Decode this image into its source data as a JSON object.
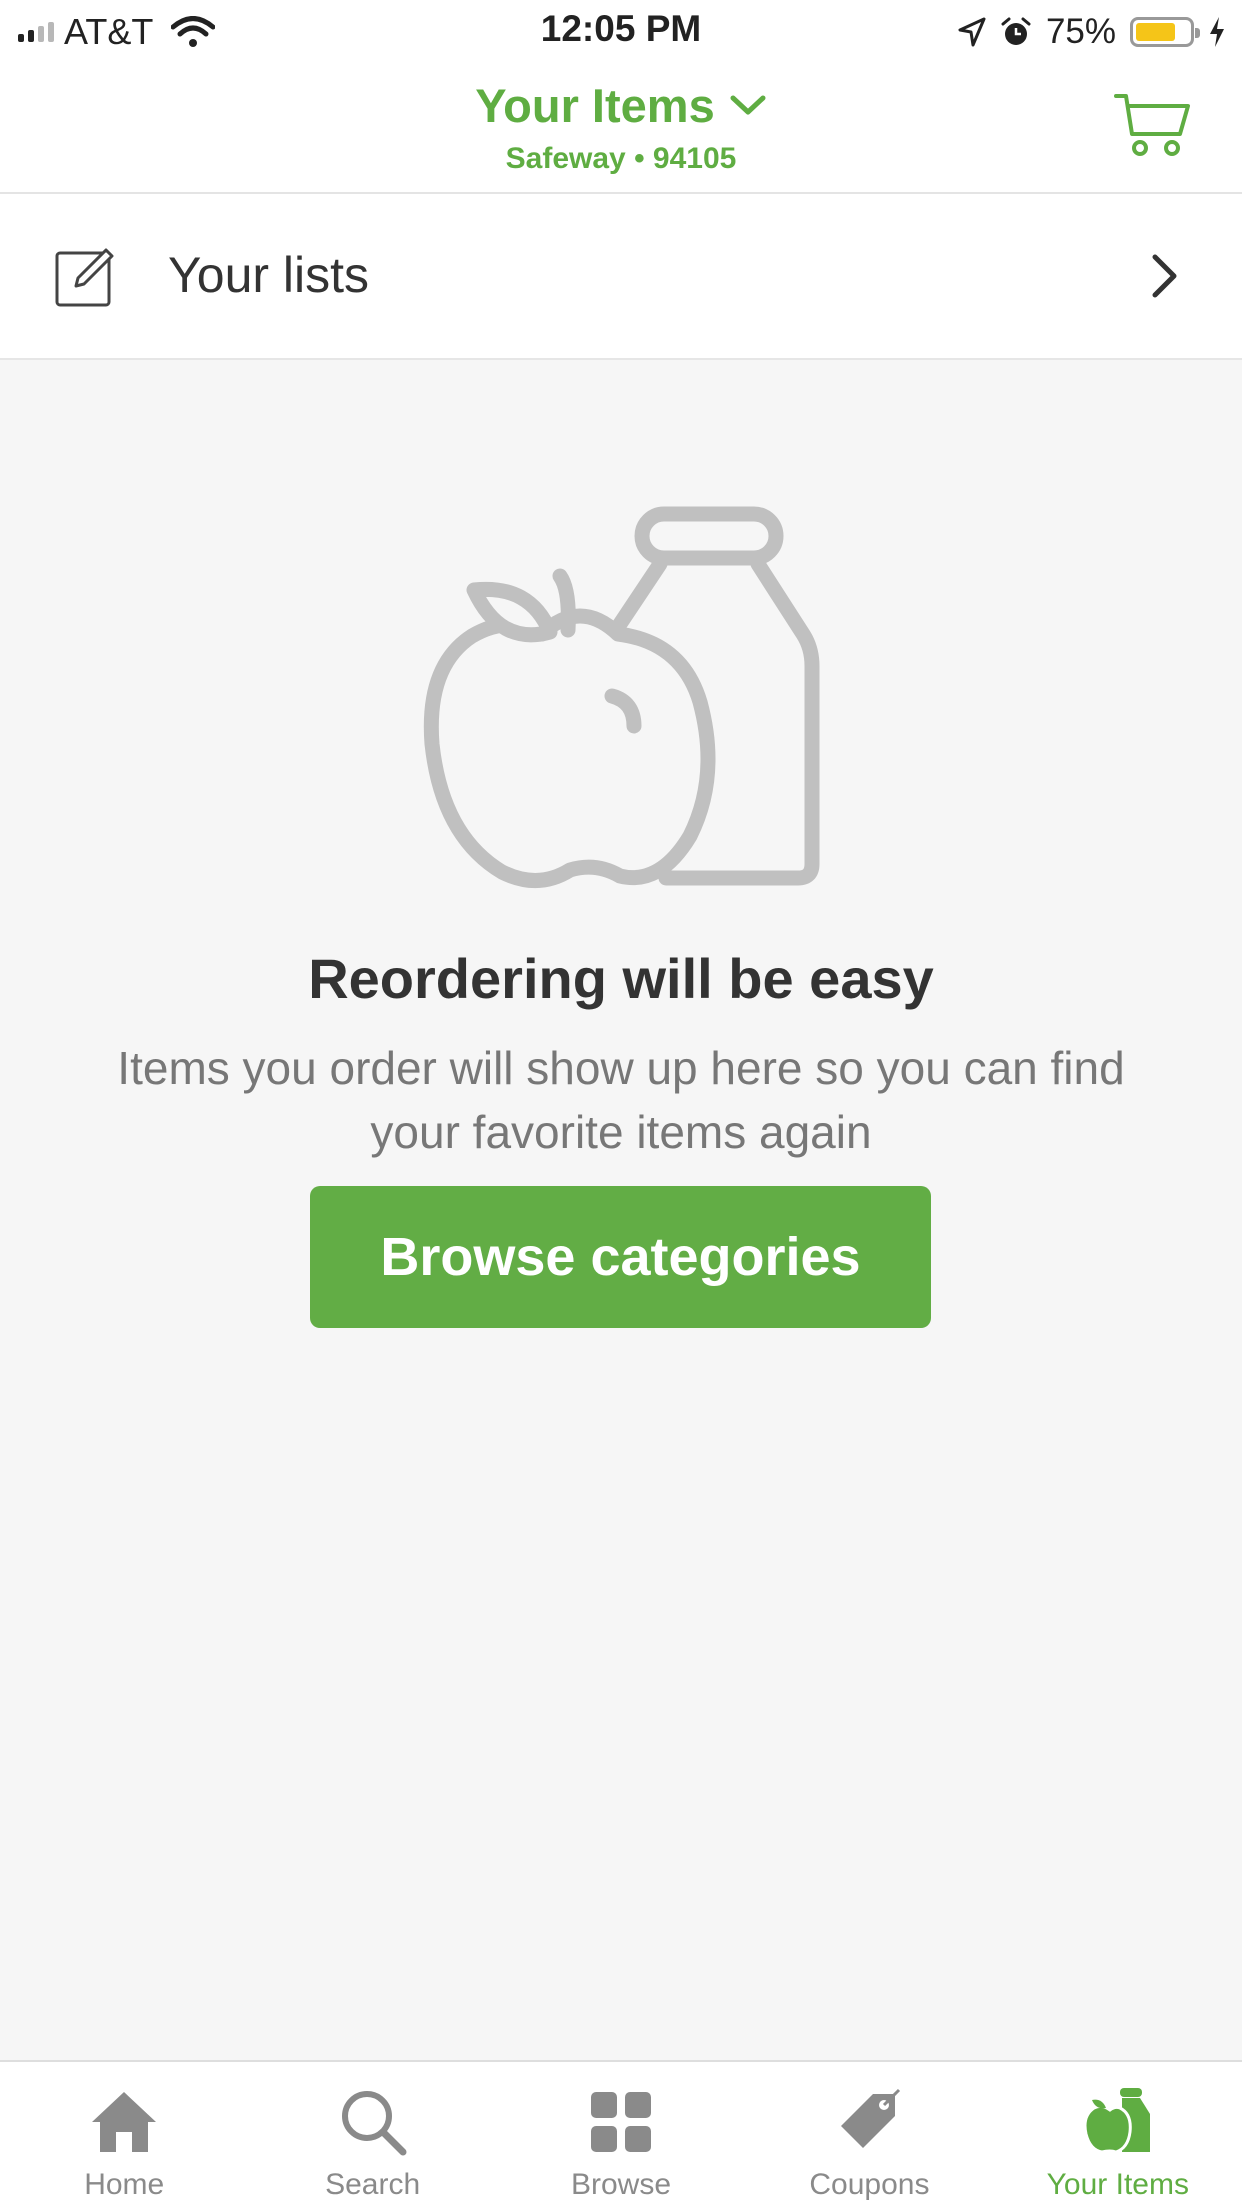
{
  "status_bar": {
    "carrier": "AT&T",
    "time": "12:05 PM",
    "battery_percent_label": "75%",
    "battery_level": 0.75,
    "icons": [
      "signal-icon",
      "wifi-icon",
      "location-icon",
      "alarm-icon",
      "battery-icon",
      "charging-icon"
    ]
  },
  "header": {
    "title": "Your Items",
    "subtitle": "Safeway • 94105",
    "icons": [
      "chevron-down-icon",
      "cart-icon"
    ]
  },
  "lists_row": {
    "label": "Your lists",
    "icons": [
      "edit-list-icon",
      "chevron-right-icon"
    ]
  },
  "empty_state": {
    "title": "Reordering will be easy",
    "message": "Items you order will show up here so you can find your favorite items again",
    "button_label": "Browse categories",
    "illustration": "apple-and-bottle-icon"
  },
  "tab_bar": {
    "tabs": [
      {
        "label": "Home",
        "icon": "home-icon",
        "active": false
      },
      {
        "label": "Search",
        "icon": "search-icon",
        "active": false
      },
      {
        "label": "Browse",
        "icon": "grid-icon",
        "active": false
      },
      {
        "label": "Coupons",
        "icon": "tag-icon",
        "active": false
      },
      {
        "label": "Your Items",
        "icon": "apple-bottle-icon",
        "active": true
      }
    ]
  },
  "colors": {
    "brand_green": "#5fad42",
    "button_green": "#62ad45",
    "background": "#f6f6f6",
    "battery_yellow": "#f5c518"
  }
}
